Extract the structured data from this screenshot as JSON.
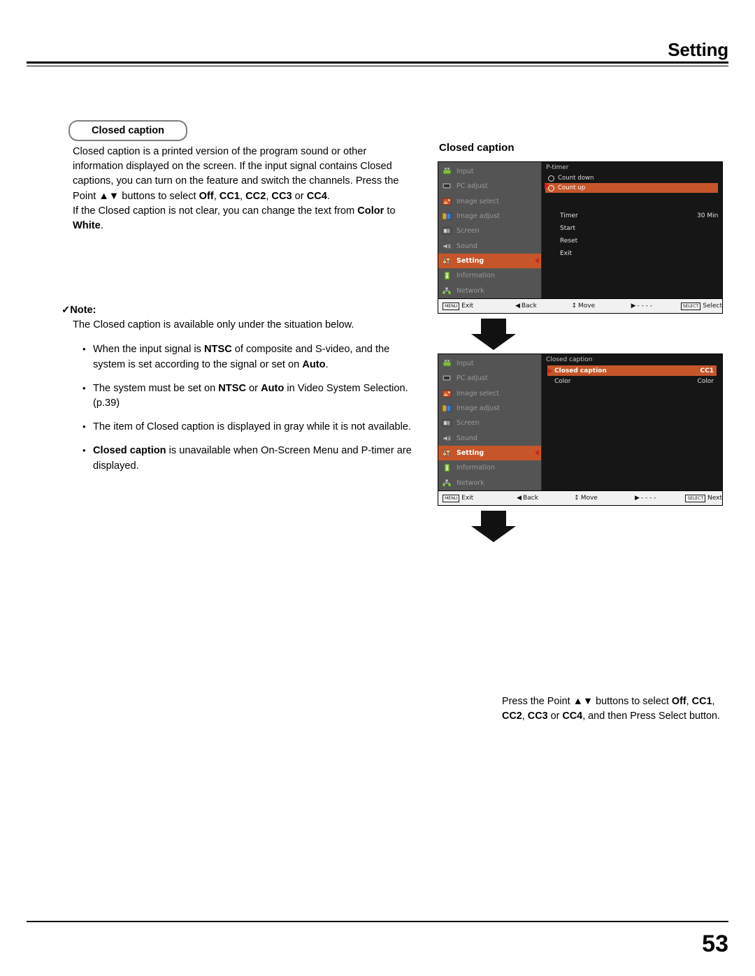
{
  "header": {
    "title": "Setting"
  },
  "footer": {
    "page_number": "53"
  },
  "section": {
    "tag_label": "Closed caption"
  },
  "body": {
    "para1_a": "Closed caption is a printed version of the program sound or other information displayed on the screen. If the input signal contains Closed captions, you can turn on the feature and switch the channels. Press the Point ",
    "para1_updown": "▲▼",
    "para1_b": " buttons to select ",
    "opt_off": "Off",
    "opt_cc1": "CC1",
    "opt_cc2": "CC2",
    "opt_cc3": "CC3",
    "opt_cc4": "CC4",
    "para1_or": " or ",
    "para1_end": ".",
    "para2_a": "If the Closed caption is not clear, you can change the text from ",
    "para2_color": "Color",
    "para2_to": " to ",
    "para2_white": "White",
    "para2_end": "."
  },
  "note": {
    "check": "✓",
    "head": "Note:",
    "intro": "The Closed caption is available only under the situation below.",
    "bullets": [
      {
        "part1": "When the input signal is ",
        "bold1": "NTSC",
        "part2": " of composite and S-video, and the system is set according to the signal or set on ",
        "bold2": "Auto",
        "part3": "."
      },
      {
        "part1": "The system must be set on ",
        "bold1": "NTSC",
        "part2": " or ",
        "bold2": "Auto",
        "part3": " in Video System Selection. (p.39)"
      },
      {
        "part1": "The item of Closed caption is displayed in gray while it is not available.",
        "bold1": "",
        "part2": "",
        "bold2": "",
        "part3": ""
      },
      {
        "part1": "",
        "bold1": "Closed caption",
        "part2": " is unavailable when On-Screen Menu and P-timer are displayed.",
        "bold2": "",
        "part3": ""
      }
    ]
  },
  "right": {
    "title": "Closed caption"
  },
  "osd_menu_items": [
    {
      "label": "Input",
      "icon": "input-icon"
    },
    {
      "label": "PC adjust",
      "icon": "pc-adjust-icon"
    },
    {
      "label": "Image select",
      "icon": "image-select-icon"
    },
    {
      "label": "Image adjust",
      "icon": "image-adjust-icon"
    },
    {
      "label": "Screen",
      "icon": "screen-icon"
    },
    {
      "label": "Sound",
      "icon": "sound-icon"
    },
    {
      "label": "Setting",
      "icon": "setting-icon"
    },
    {
      "label": "Information",
      "icon": "information-icon"
    },
    {
      "label": "Network",
      "icon": "network-icon"
    }
  ],
  "osd1": {
    "panel_title": "P-timer",
    "rows": [
      {
        "label": "Count down",
        "highlight": false
      },
      {
        "label": "Count up",
        "highlight": true
      }
    ],
    "settings": [
      {
        "label": "Timer",
        "value": "30 Min"
      },
      {
        "label": "Start",
        "value": ""
      },
      {
        "label": "Reset",
        "value": ""
      },
      {
        "label": "Exit",
        "value": ""
      }
    ],
    "bar": {
      "menu_key": "MENU",
      "exit": "Exit",
      "back_glyph": "◀",
      "back": "Back",
      "move_glyph": "↕",
      "move": "Move",
      "adjust_glyph": "▶",
      "adjust": "- - - -",
      "select_key": "SELECT",
      "select": "Select"
    }
  },
  "osd2": {
    "panel_title": "Closed caption",
    "rows": [
      {
        "label": "Closed caption",
        "value": "CC1",
        "highlight": true
      },
      {
        "label": "Color",
        "value": "Color",
        "highlight": false
      }
    ],
    "bar": {
      "menu_key": "MENU",
      "exit": "Exit",
      "back_glyph": "◀",
      "back": "Back",
      "move_glyph": "↕",
      "move": "Move",
      "adjust_glyph": "▶",
      "adjust": "- - - -",
      "select_key": "SELECT",
      "select": "Next"
    }
  },
  "bottom_caption": {
    "line1_a": "Press the Point ",
    "line1_updown": "▲▼",
    "line1_b": " buttons to select ",
    "opt_off": "Off",
    "opt_cc1": "CC1",
    "opt_cc2": "CC2",
    "opt_cc3": "CC3",
    "opt_cc4": "CC4",
    "or": " or ",
    "line_end": ", and then Press Select button."
  },
  "colors": {
    "accent_orange": "#c6562a",
    "menu_gray": "#545454",
    "panel_black": "#161616",
    "cursor_red": "#d02020"
  }
}
